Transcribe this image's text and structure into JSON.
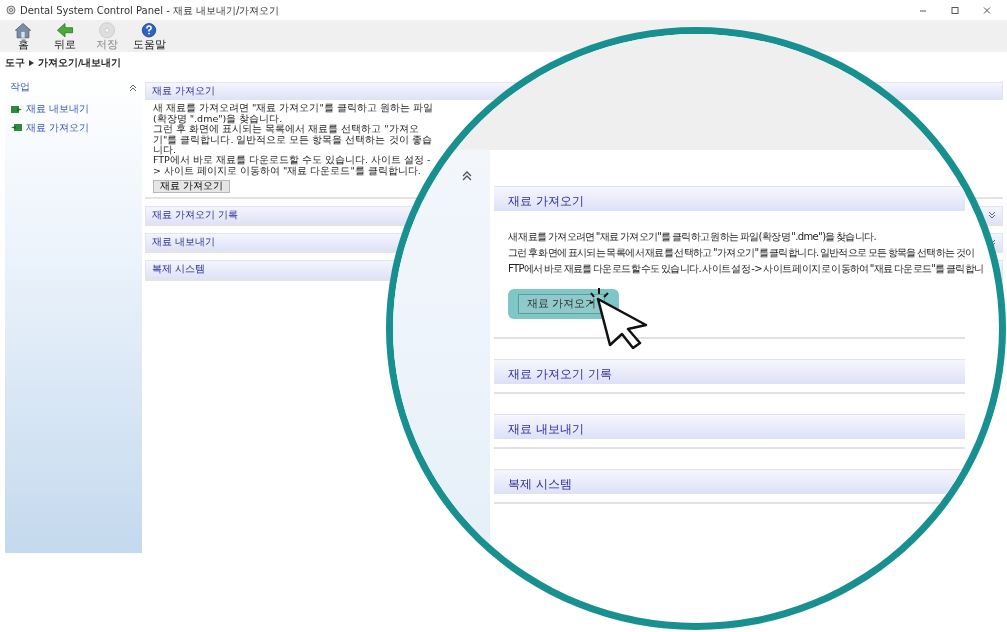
{
  "window": {
    "title": "Dental System Control Panel - 재료 내보내기/가져오기"
  },
  "toolbar": [
    {
      "label": "홈",
      "kind": "home",
      "disabled": false
    },
    {
      "label": "뒤로",
      "kind": "back",
      "disabled": false
    },
    {
      "label": "저장",
      "kind": "save",
      "disabled": true
    },
    {
      "label": "도움말",
      "kind": "help",
      "disabled": false
    }
  ],
  "breadcrumb": [
    "도구",
    "가져오기/내보내기"
  ],
  "sidebar": {
    "title": "작업",
    "items": [
      {
        "label": "재료 내보내기",
        "kind": "export"
      },
      {
        "label": "재료 가져오기",
        "kind": "import"
      }
    ]
  },
  "sections": [
    {
      "title": "재료 가져오기",
      "expanded": true,
      "lines": [
        "새 재료를 가져오려면 \"재료 가져오기\"를 클릭하고 원하는 파일(확장명 \".dme\")을 찾습니다.",
        "그런 후 화면에 표시되는 목록에서 재료를 선택하고 \"가져오기\"를 클릭합니다. 일반적으로 모든 항목을 선택하는 것이 좋습니다.",
        "FTP에서 바로 재료를 다운로드할 수도 있습니다. 사이트 설정 -> 사이트 페이지로 이동하여 \"재료 다운로드\"를 클릭합니다."
      ],
      "button": "재료 가져오기"
    },
    {
      "title": "재료 가져오기 기록",
      "expanded": false
    },
    {
      "title": "재료 내보내기",
      "expanded": false
    },
    {
      "title": "복제 시스템",
      "expanded": false
    }
  ],
  "magnifier": {
    "sections": [
      {
        "title": "재료 가져오기",
        "lines": [
          "새 재료를 가져오려면 \"재료 가져오기\"를 클릭하고 원하는 파일(확장명 \".dme\")을 찾습니다.",
          "그런 후 화면에 표시되는 목록에서 재료를 선택하고 \"가져오기\"를 클릭합니다. 일반적으로 모든 항목을 선택하는 것이",
          "FTP에서 바로 재료를 다운로드할 수도 있습니다. 사이트 설정 -> 사이트 페이지로 이동하여 \"재료 다운로드\"를 클릭합니"
        ],
        "button": "재료 가져오기"
      },
      {
        "title": "재료 가져오기 기록"
      },
      {
        "title": "재료 내보내기"
      },
      {
        "title": "복제 시스템"
      }
    ]
  }
}
